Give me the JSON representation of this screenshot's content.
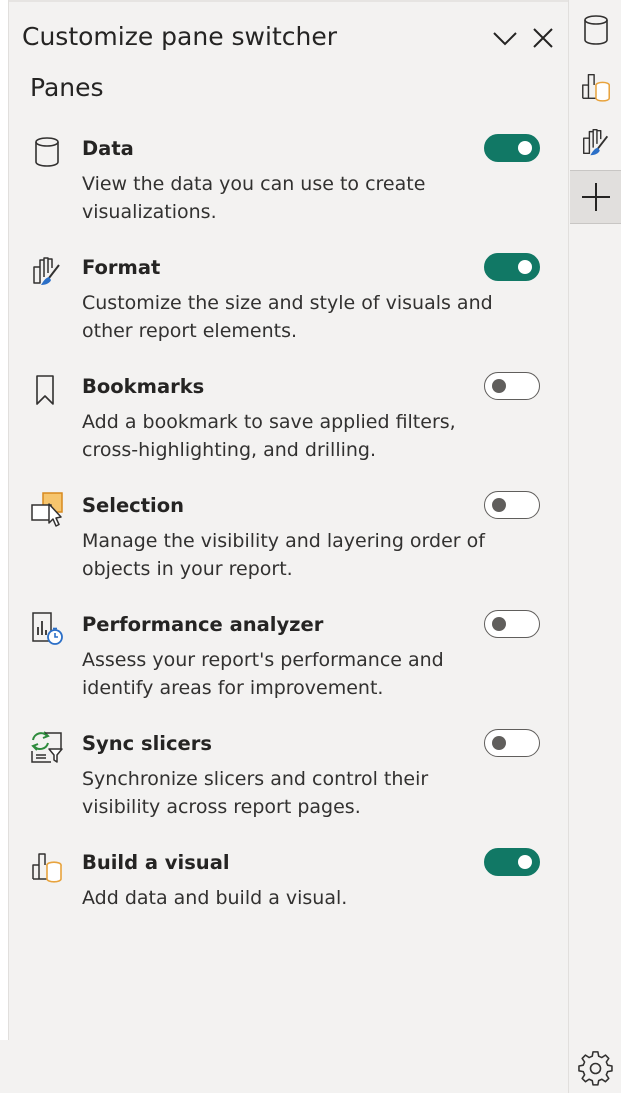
{
  "pane": {
    "title": "Customize pane switcher",
    "collapse_icon": "chevron-down-icon",
    "close_icon": "close-icon"
  },
  "section": {
    "title": "Panes"
  },
  "items": [
    {
      "icon": "database-icon",
      "label": "Data",
      "description": "View the data you can use to create visualizations.",
      "enabled": true
    },
    {
      "icon": "format-brush-icon",
      "label": "Format",
      "description": "Customize the size and style of visuals and other report elements.",
      "enabled": true
    },
    {
      "icon": "bookmark-icon",
      "label": "Bookmarks",
      "description": "Add a bookmark to save applied filters, cross-highlighting, and drilling.",
      "enabled": false
    },
    {
      "icon": "selection-icon",
      "label": "Selection",
      "description": "Manage the visibility and layering order of objects in your report.",
      "enabled": false
    },
    {
      "icon": "performance-analyzer-icon",
      "label": "Performance analyzer",
      "description": "Assess your report's performance and identify areas for improvement.",
      "enabled": false
    },
    {
      "icon": "sync-slicers-icon",
      "label": "Sync slicers",
      "description": "Synchronize slicers and control their visibility across report pages.",
      "enabled": false
    },
    {
      "icon": "build-visual-icon",
      "label": "Build a visual",
      "description": "Add data and build a visual.",
      "enabled": true
    }
  ],
  "rail": {
    "buttons": [
      {
        "icon": "database-icon"
      },
      {
        "icon": "build-visual-icon"
      },
      {
        "icon": "format-brush-icon"
      },
      {
        "icon": "add-icon",
        "active": true
      }
    ],
    "settings_icon": "gear-icon"
  },
  "colors": {
    "toggle_on": "#117865",
    "toggle_off_border": "#605e5c",
    "accent_orange": "#e8a33d",
    "accent_blue": "#2b6fc7",
    "accent_green": "#2e8b3d"
  }
}
